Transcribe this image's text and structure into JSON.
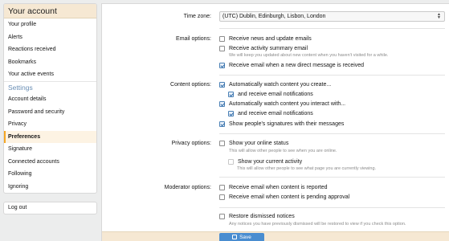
{
  "sidebar": {
    "title": "Your account",
    "items_top": [
      {
        "label": "Your profile"
      },
      {
        "label": "Alerts"
      },
      {
        "label": "Reactions received"
      },
      {
        "label": "Bookmarks"
      },
      {
        "label": "Your active events"
      }
    ],
    "settings_label": "Settings",
    "items_settings": [
      {
        "label": "Account details"
      },
      {
        "label": "Password and security"
      },
      {
        "label": "Privacy"
      },
      {
        "label": "Preferences",
        "active": true
      },
      {
        "label": "Signature"
      },
      {
        "label": "Connected accounts"
      },
      {
        "label": "Following"
      },
      {
        "label": "Ignoring"
      }
    ],
    "logout": "Log out"
  },
  "form": {
    "timezone_label": "Time zone:",
    "timezone_value": "(UTC) Dublin, Edinburgh, Lisbon, London",
    "email_label": "Email options:",
    "email_news": "Receive news and update emails",
    "email_summary": "Receive activity summary email",
    "email_summary_hint": "We will keep you updated about new content when you haven't visited for a while.",
    "email_dm": "Receive email when a new direct message is received",
    "content_label": "Content options:",
    "watch_create": "Automatically watch content you create...",
    "watch_create_notify": "and receive email notifications",
    "watch_interact": "Automatically watch content you interact with...",
    "watch_interact_notify": "and receive email notifications",
    "show_signatures": "Show people's signatures with their messages",
    "privacy_label": "Privacy options:",
    "show_online": "Show your online status",
    "show_online_hint": "This will allow other people to see when you are online.",
    "show_activity": "Show your current activity",
    "show_activity_hint": "This will allow other people to see what page you are currently viewing.",
    "moderator_label": "Moderator options:",
    "mod_reported": "Receive email when content is reported",
    "mod_approval": "Receive email when content is pending approval",
    "restore_notices": "Restore dismissed notices",
    "restore_notices_hint": "Any notices you have previously dismissed will be restored to view if you check this option.",
    "save": "Save"
  },
  "colors": {
    "accent": "#4a8dd0",
    "header_bg": "#f6e8d3",
    "settings_blue": "#6b8fb5"
  }
}
